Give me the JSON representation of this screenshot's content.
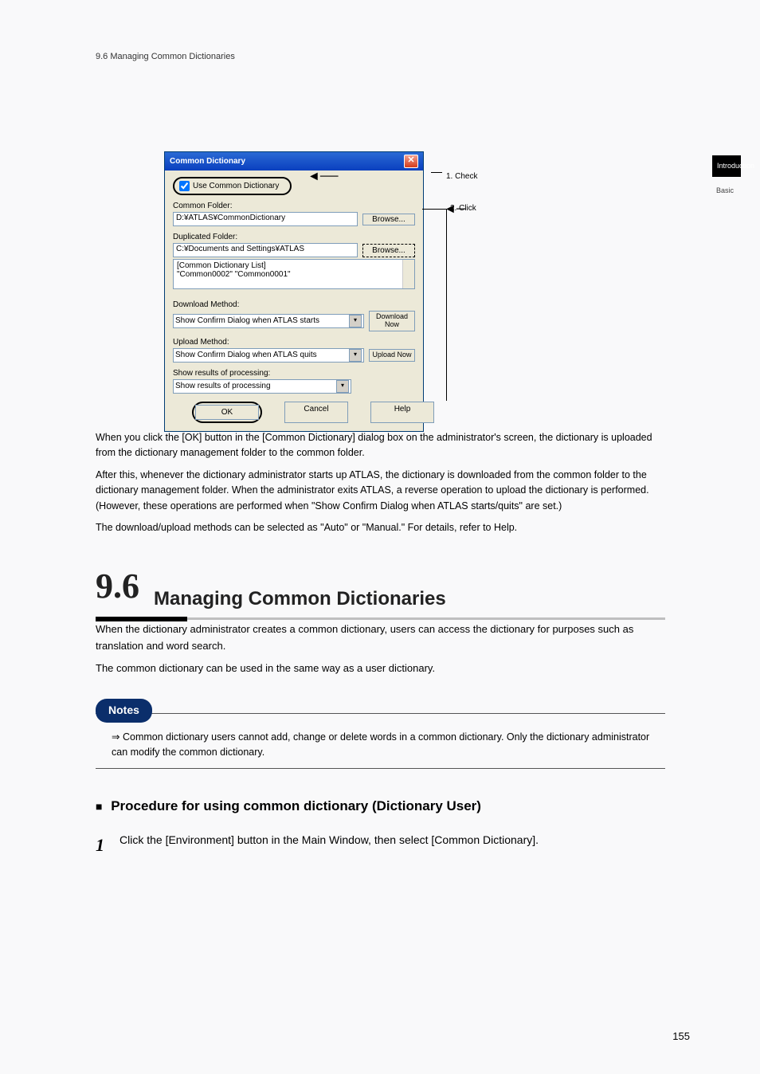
{
  "page_header": "9.6 Managing Common Dictionaries",
  "chapter_sidebar": {
    "top": "Introduction",
    "bottom": "Basic"
  },
  "dialog": {
    "title": "Common Dictionary",
    "use_common": "Use Common Dictionary",
    "common_folder_lbl": "Common Folder:",
    "common_folder_val": "D:¥ATLAS¥CommonDictionary",
    "browse1": "Browse...",
    "dup_folder_lbl": "Duplicated Folder:",
    "dup_folder_val": "C:¥Documents and Settings¥ATLAS",
    "browse2": "Browse...",
    "list_header": "[Common Dictionary List]",
    "list_val": "\"Common0002\"  \"Common0001\"",
    "dl_method_lbl": "Download Method:",
    "dl_method_val": "Show Confirm Dialog when ATLAS starts",
    "dl_now": "Download Now",
    "ul_method_lbl": "Upload Method:",
    "ul_method_val": "Show Confirm Dialog when ATLAS quits",
    "ul_now": "Upload Now",
    "show_results_lbl": "Show results of processing:",
    "show_results_val": "Show results of processing",
    "ok": "OK",
    "cancel": "Cancel",
    "help": "Help"
  },
  "callouts": {
    "c1": "1. Check",
    "c2": "2. Click"
  },
  "body": {
    "step5": "When you click the [OK] button in the [Common Dictionary] dialog box on the administrator's screen, the dictionary is uploaded from the dictionary management folder to the common folder.",
    "step5b": "After this, whenever the dictionary administrator starts up ATLAS, the dictionary is downloaded from the common folder to the dictionary management folder. When the administrator exits ATLAS, a reverse operation to upload the dictionary is performed. (However, these operations are performed when \"Show Confirm Dialog when ATLAS starts/quits\" are set.)",
    "step5c": "The download/upload methods can be selected as \"Auto\" or \"Manual.\" For details, refer to Help."
  },
  "section": {
    "num": "9.6",
    "title": "Managing Common Dictionaries",
    "lead1": "When the dictionary administrator creates a common dictionary, users can access the dictionary for purposes such as translation and word search.",
    "lead2": "The common dictionary can be used in the same way as a user dictionary.",
    "note": "Common dictionary users cannot add, change or delete words in a common dictionary. Only the dictionary administrator can modify the common dictionary.",
    "proc_head": "Procedure for using common dictionary (Dictionary User)",
    "step1": "Click the [Environment] button in the Main Window, then select [Common Dictionary]."
  },
  "page_number": "155"
}
